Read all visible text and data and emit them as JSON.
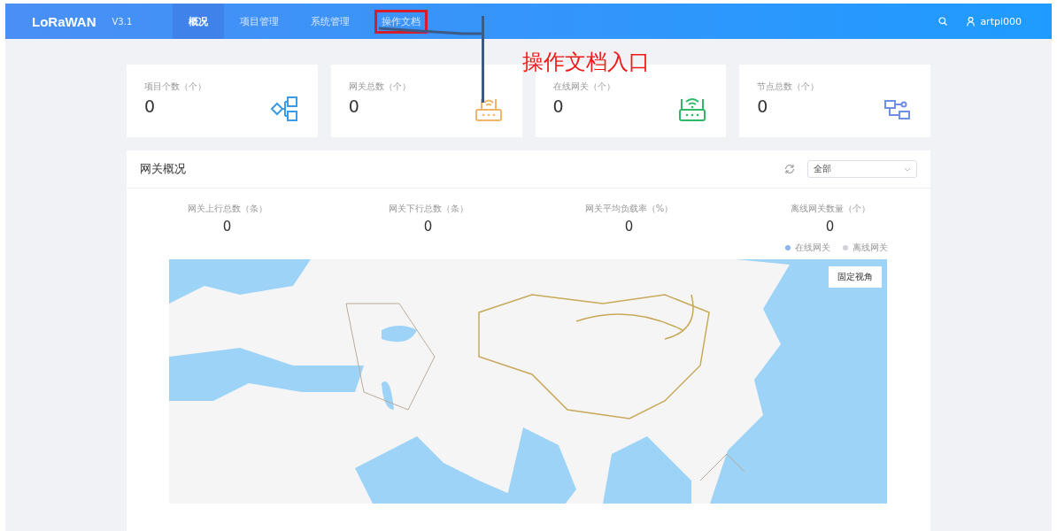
{
  "header": {
    "logo": "LoRaWAN",
    "version": "V3.1",
    "nav": [
      {
        "label": "概况",
        "selected": true,
        "annotated": false
      },
      {
        "label": "项目管理",
        "selected": false,
        "annotated": false
      },
      {
        "label": "系统管理",
        "selected": false,
        "annotated": false
      },
      {
        "label": "操作文档",
        "selected": false,
        "annotated": true
      }
    ],
    "user": "artpi000"
  },
  "annotation": {
    "text": "操作文档入口"
  },
  "cards": [
    {
      "label": "项目个数（个）",
      "value": "0",
      "kind": "tree",
      "color": "#3a9be8"
    },
    {
      "label": "网关总数（个）",
      "value": "0",
      "kind": "router",
      "color": "#f0b46a"
    },
    {
      "label": "在线网关（个）",
      "value": "0",
      "kind": "router-wifi",
      "color": "#2fb86a"
    },
    {
      "label": "节点总数（个）",
      "value": "0",
      "kind": "nodes",
      "color": "#6f8fe6"
    }
  ],
  "panel": {
    "title": "网关概况",
    "filter": {
      "value": "全部"
    },
    "stats": [
      {
        "label": "网关上行总数（条）",
        "value": "0"
      },
      {
        "label": "网关下行总数（条）",
        "value": "0"
      },
      {
        "label": "网关平均负载率（%）",
        "value": "0"
      },
      {
        "label": "离线网关数量（个）",
        "value": "0"
      }
    ],
    "legend": [
      {
        "label": "在线网关",
        "color": "#8fb3ec"
      },
      {
        "label": "离线网关",
        "color": "#d0d3d8"
      }
    ],
    "map": {
      "kind": "picture",
      "button": "固定视角"
    }
  }
}
